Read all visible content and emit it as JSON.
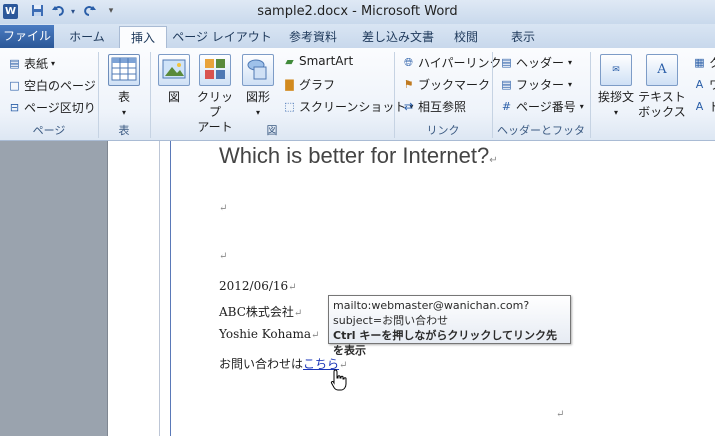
{
  "window": {
    "title": "sample2.docx - Microsoft Word",
    "app_icon": "W"
  },
  "tabs": {
    "file": "ファイル",
    "items": [
      "ホーム",
      "挿入",
      "ページ レイアウト",
      "参考資料",
      "差し込み文書",
      "校閲",
      "表示"
    ],
    "active": "挿入"
  },
  "ribbon": {
    "page_group": {
      "label": "ページ",
      "cover": "表紙",
      "blank_page": "空白のページ",
      "page_break": "ページ区切り"
    },
    "table_group": {
      "label": "表",
      "table": "表"
    },
    "illust_group": {
      "label": "図",
      "picture": "図",
      "clipart_1": "クリップ",
      "clipart_2": "アート",
      "shapes": "図形",
      "smartart": "SmartArt",
      "chart": "グラフ",
      "screenshot": "スクリーンショット"
    },
    "link_group": {
      "label": "リンク",
      "hyperlink": "ハイパーリンク",
      "bookmark": "ブックマーク",
      "crossref": "相互参照"
    },
    "hf_group": {
      "label": "ヘッダーとフッター",
      "header": "ヘッダー",
      "footer": "フッター",
      "page_number": "ページ番号"
    },
    "text_group": {
      "greeting": "挨拶文",
      "textbox_1": "テキスト",
      "textbox_2": "ボックス",
      "partial_1": "ク",
      "partial_2": "ワ",
      "partial_3": "ド"
    }
  },
  "document": {
    "heading": "Which is better for Internet?",
    "date": "2012/06/16",
    "company": "ABC株式会社",
    "name": "Yoshie Kohama",
    "contact_prefix": "お問い合わせは",
    "contact_link": "こちら",
    "paragraph_mark": "↵"
  },
  "tooltip": {
    "line1": "mailto:webmaster@wanichan.com?",
    "line2": "subject=お問い合わせ",
    "line3_key": "Ctrl",
    "line3_rest": " キーを押しながらクリックしてリンク先を表示"
  }
}
